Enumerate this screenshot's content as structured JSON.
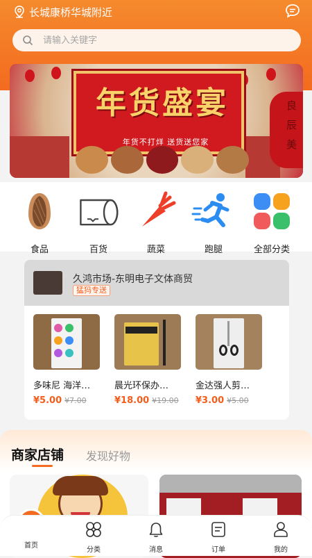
{
  "header": {
    "location": "长城康桥华城附近",
    "location_icon": "location-pin-icon",
    "message_icon": "chat-bubble-icon",
    "accent_color": "#f36b1f"
  },
  "search": {
    "placeholder": "请输入关键字"
  },
  "banner": {
    "title": "年货盛宴",
    "subtitle": "年货不打烊 送货送您家",
    "side_text": "良辰美"
  },
  "categories": [
    {
      "label": "食品",
      "icon": "almond-icon"
    },
    {
      "label": "百货",
      "icon": "tissue-roll-icon"
    },
    {
      "label": "蔬菜",
      "icon": "carrot-icon"
    },
    {
      "label": "跑腿",
      "icon": "runner-icon"
    },
    {
      "label": "全部分类",
      "icon": "grid-four-icon"
    }
  ],
  "store_card": {
    "title": "久鸿市场-东明电子文体商贸",
    "tag": "猛犸专送",
    "products": [
      {
        "name": "多味尼 海洋…",
        "price": "¥5.00",
        "old_price": "¥7.00"
      },
      {
        "name": "晨光环保办…",
        "price": "¥18.00",
        "old_price": "¥19.00"
      },
      {
        "name": "金达强人剪…",
        "price": "¥3.00",
        "old_price": "¥5.00"
      }
    ]
  },
  "shop_section": {
    "active_tab": "商家店铺",
    "inactive_tab": "发现好物"
  },
  "tabbar": [
    {
      "label": "首页",
      "icon": "home-icon"
    },
    {
      "label": "分类",
      "icon": "category-icon"
    },
    {
      "label": "消息",
      "icon": "bell-icon"
    },
    {
      "label": "订单",
      "icon": "order-icon"
    },
    {
      "label": "我的",
      "icon": "user-icon"
    }
  ]
}
